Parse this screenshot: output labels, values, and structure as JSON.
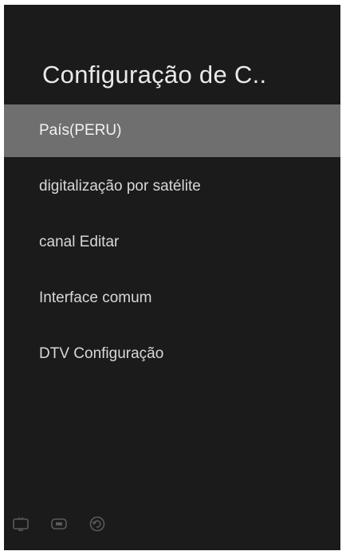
{
  "panel": {
    "title": "Configuração de C.."
  },
  "menu": {
    "items": [
      {
        "label": "País(PERU)",
        "selected": true
      },
      {
        "label": "digitalização por satélite",
        "selected": false
      },
      {
        "label": "canal Editar",
        "selected": false
      },
      {
        "label": "Interface comum",
        "selected": false
      },
      {
        "label": "DTV Configuração",
        "selected": false
      }
    ]
  },
  "footer": {
    "hints": [
      {
        "icon": "tv-icon",
        "label": ""
      },
      {
        "icon": "exit-button-icon",
        "label": ""
      },
      {
        "icon": "back-arrow-icon",
        "label": ""
      }
    ]
  }
}
